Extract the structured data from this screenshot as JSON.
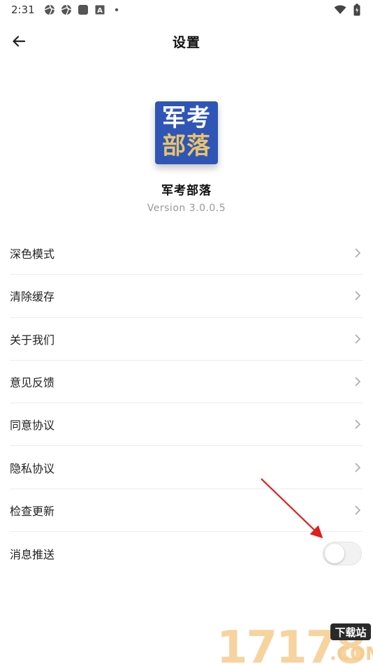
{
  "status_bar": {
    "time": "2:31",
    "left_icons": [
      "aperture-icon",
      "aperture-icon",
      "square-app-icon",
      "font-a-icon",
      "dot-icon"
    ],
    "right_icons": [
      "wifi-icon",
      "battery-icon"
    ]
  },
  "app_bar": {
    "title": "设置",
    "back_icon": "arrow-left-icon"
  },
  "app_info": {
    "logo_text_top": "军考",
    "logo_text_bottom": "部落",
    "name": "军考部落",
    "version": "Version 3.0.0.5",
    "logo_color": "#2f55b7",
    "logo_accent_color": "#e8c36a"
  },
  "settings": {
    "items": [
      {
        "label": "深色模式"
      },
      {
        "label": "清除缓存"
      },
      {
        "label": "关于我们"
      },
      {
        "label": "意见反馈"
      },
      {
        "label": "同意协议"
      },
      {
        "label": "隐私协议"
      },
      {
        "label": "检查更新"
      }
    ],
    "push": {
      "label": "消息推送",
      "enabled": false
    }
  },
  "annotation": {
    "arrow_color": "#e11d1d"
  },
  "watermark": {
    "number": "17178",
    "badge": "下载站",
    "domain": ".COM"
  }
}
